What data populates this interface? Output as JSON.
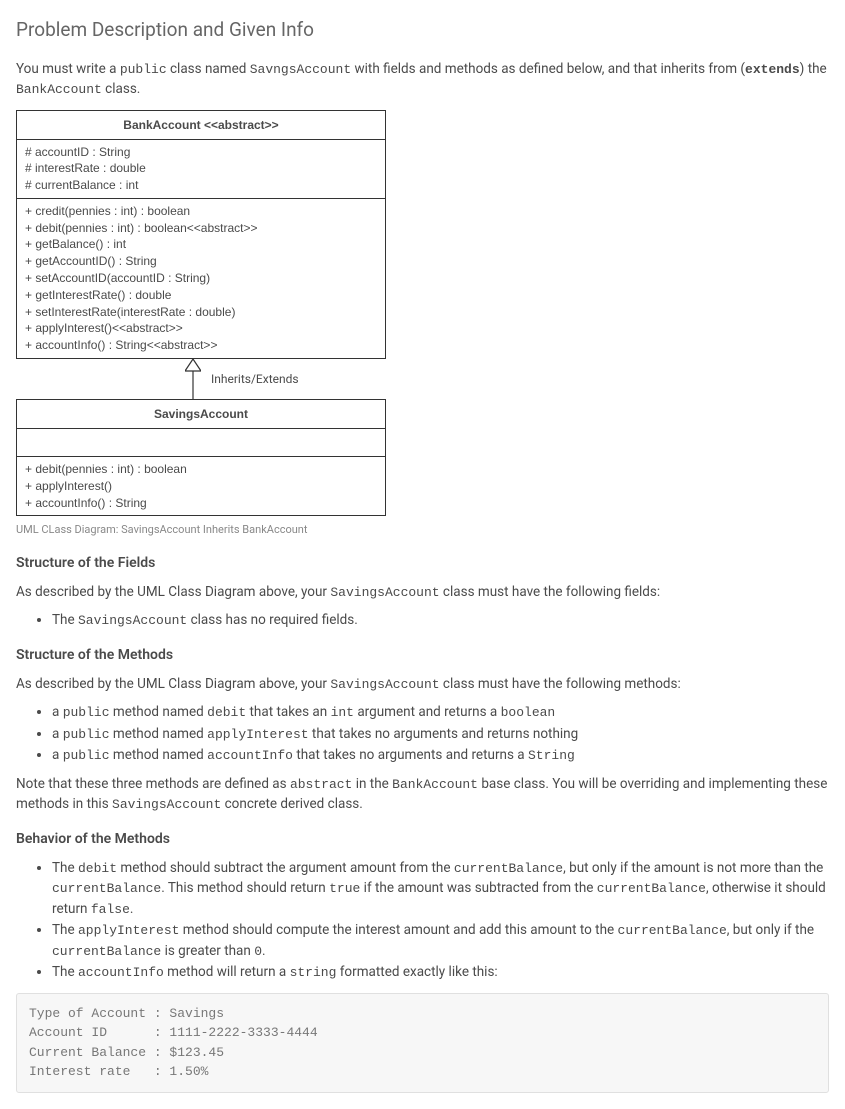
{
  "heading": "Problem Description and Given Info",
  "intro": {
    "pre": "You must write a ",
    "kw_public": "public",
    "mid1": " class named ",
    "kw_savngs": "SavngsAccount",
    "mid2": " with fields and methods as defined below, and that inherits from (",
    "kw_extends": "extends",
    "mid3": ") the ",
    "kw_bankaccount": "BankAccount",
    "post": " class."
  },
  "uml": {
    "bankaccount": {
      "title": "BankAccount <<abstract>>",
      "fields": [
        "# accountID : String",
        "# interestRate : double",
        "# currentBalance : int"
      ],
      "methods": [
        "+ credit(pennies : int) : boolean",
        "+ debit(pennies : int) : boolean<<abstract>>",
        "+ getBalance() : int",
        "+ getAccountID() : String",
        "+ setAccountID(accountID : String)",
        "+ getInterestRate() : double",
        "+ setInterestRate(interestRate : double)",
        "+ applyInterest()<<abstract>>",
        "+ accountInfo() : String<<abstract>>"
      ]
    },
    "arrow_label": "Inherits/Extends",
    "savingsaccount": {
      "title": "SavingsAccount",
      "methods": [
        "+ debit(pennies : int) : boolean",
        "+ applyInterest()",
        "+ accountInfo() : String"
      ]
    }
  },
  "caption": "UML CLass Diagram: SavingsAccount Inherits BankAccount",
  "fields_heading": "Structure of the Fields",
  "fields_intro": {
    "pre": "As described by the UML Class Diagram above, your ",
    "kw": "SavingsAccount",
    "post": " class must have the following fields:"
  },
  "fields_bullet": {
    "pre": "The ",
    "kw": "SavingsAccount",
    "post": " class has no required fields."
  },
  "methods_heading": "Structure of the Methods",
  "methods_intro": {
    "pre": "As described by the UML Class Diagram above, your ",
    "kw": "SavingsAccount",
    "post": " class must have the following methods:"
  },
  "method_bullets": {
    "b1": {
      "a": "a ",
      "public": "public",
      "b": " method named ",
      "name": "debit",
      "c": " that takes an ",
      "int": "int",
      "d": " argument and returns a ",
      "ret": "boolean"
    },
    "b2": {
      "a": "a ",
      "public": "public",
      "b": " method named ",
      "name": "applyInterest",
      "c": " that takes no arguments and returns nothing"
    },
    "b3": {
      "a": "a ",
      "public": "public",
      "b": " method named ",
      "name": "accountInfo",
      "c": " that takes no arguments and returns a ",
      "ret": "String"
    }
  },
  "note": {
    "pre": "Note that these three methods are defined as ",
    "kw_abstract": "abstract",
    "mid1": " in the ",
    "kw_bank": "BankAccount",
    "mid2": " base class. You will be overriding and implementing these methods in this ",
    "kw_savings": "SavingsAccount",
    "post": " concrete derived class."
  },
  "behavior_heading": "Behavior of the Methods",
  "behavior": {
    "b1": {
      "a": "The ",
      "debit": "debit",
      "b": " method should subtract the argument amount from the ",
      "cb1": "currentBalance",
      "c": ", but only if the amount is not more than the ",
      "cb2": "currentBalance",
      "d": ". This method should return ",
      "true": "true",
      "e": " if the amount was subtracted from the ",
      "cb3": "currentBalance",
      "f": ", otherwise it should return ",
      "false": "false",
      "g": "."
    },
    "b2": {
      "a": "The ",
      "apply": "applyInterest",
      "b": " method should compute the interest amount and add this amount to the ",
      "cb": "currentBalance",
      "c": ", but only if the ",
      "cb2": "currentBalance",
      "d": " is greater than ",
      "zero": "0",
      "e": "."
    },
    "b3": {
      "a": "The ",
      "ai": "accountInfo",
      "b": " method will return a ",
      "str": "string",
      "c": " formatted exactly like this:"
    }
  },
  "codeblock": "Type of Account : Savings\nAccount ID      : 1111-2222-3333-4444\nCurrent Balance : $123.45\nInterest rate   : 1.50%"
}
